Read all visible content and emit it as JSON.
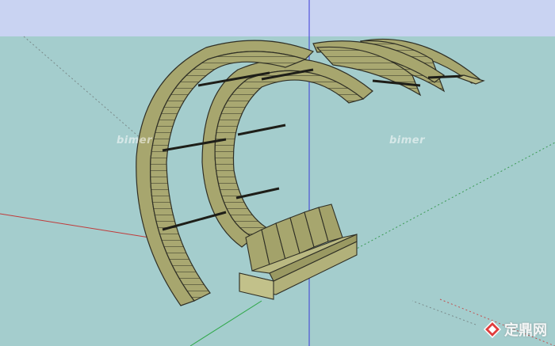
{
  "viewport": {
    "sky_color": "#C9D3F2",
    "ground_color": "#A4CDCD"
  },
  "watermarks": {
    "left": "bimer",
    "right": "bimer"
  },
  "brand": {
    "text": "定鼎网",
    "logo_icon": "diamond-logo-icon"
  },
  "model": {
    "material_color": "#A7A66E",
    "edge_color": "#2F2F25",
    "seat_count": 6
  }
}
